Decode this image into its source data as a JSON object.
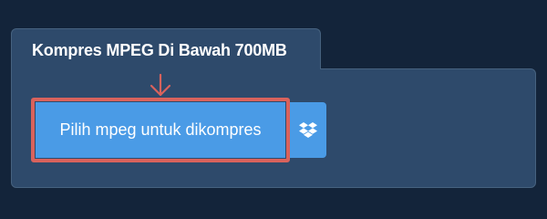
{
  "panel": {
    "title": "Kompres MPEG Di Bawah 700MB"
  },
  "upload": {
    "label": "Pilih mpeg untuk dikompres"
  },
  "icons": {
    "pointer": "arrow-down-icon",
    "dropbox": "dropbox-icon"
  },
  "colors": {
    "background": "#13243a",
    "panel": "#2e4a6b",
    "button": "#4a9be6",
    "highlight": "#d9625c"
  }
}
